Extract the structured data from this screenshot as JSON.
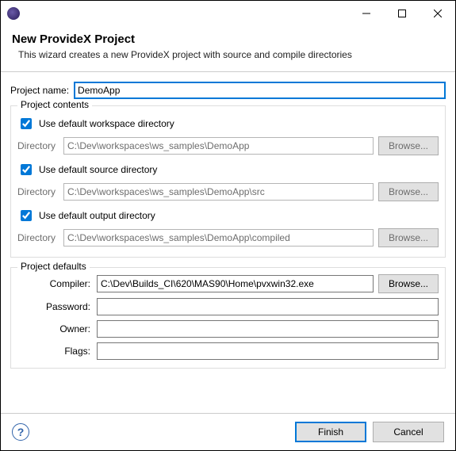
{
  "window": {
    "title_icon": "eclipse"
  },
  "header": {
    "title": "New ProvideX Project",
    "subtitle": "This wizard creates a new ProvideX project with source and compile directories"
  },
  "project_name": {
    "label": "Project name:",
    "value": "DemoApp"
  },
  "contents": {
    "group_title": "Project contents",
    "use_default_workspace": {
      "label": "Use default workspace directory",
      "checked": true
    },
    "workspace_dir": {
      "label": "Directory",
      "value": "C:\\Dev\\workspaces\\ws_samples\\DemoApp",
      "browse": "Browse..."
    },
    "use_default_source": {
      "label": "Use default source directory",
      "checked": true
    },
    "source_dir": {
      "label": "Directory",
      "value": "C:\\Dev\\workspaces\\ws_samples\\DemoApp\\src",
      "browse": "Browse..."
    },
    "use_default_output": {
      "label": "Use default output directory",
      "checked": true
    },
    "output_dir": {
      "label": "Directory",
      "value": "C:\\Dev\\workspaces\\ws_samples\\DemoApp\\compiled",
      "browse": "Browse..."
    }
  },
  "defaults": {
    "group_title": "Project defaults",
    "compiler": {
      "label": "Compiler:",
      "value": "C:\\Dev\\Builds_CI\\620\\MAS90\\Home\\pvxwin32.exe",
      "browse": "Browse..."
    },
    "password": {
      "label": "Password:",
      "value": ""
    },
    "owner": {
      "label": "Owner:",
      "value": ""
    },
    "flags": {
      "label": "Flags:",
      "value": ""
    }
  },
  "footer": {
    "help": "?",
    "finish": "Finish",
    "cancel": "Cancel"
  }
}
